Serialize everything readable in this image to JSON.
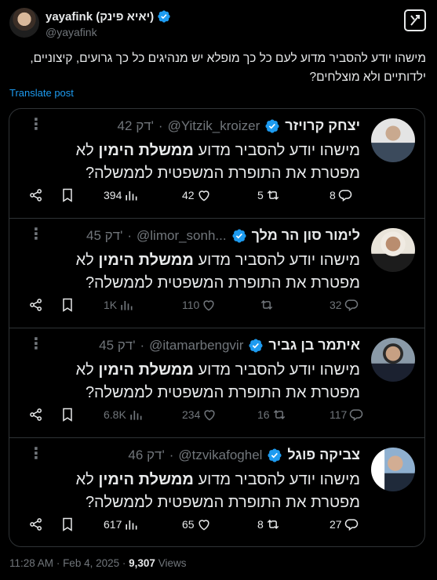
{
  "author": {
    "display_name": "yayafink (יאיא פינק)",
    "handle": "@yayafink"
  },
  "tweet": {
    "text": "מישהו יודע להסביר מדוע לעם כל כך מופלא יש מנהיגים כל כך גרועים, קיצוניים, ילדותיים ולא מוצלחים?"
  },
  "translate_label": "Translate post",
  "quotes": [
    {
      "name": "יצחק קרויזר",
      "handle": "@Yitzik_kroizer",
      "time": "42 דק'",
      "text_pre": "מישהו יודע להסביר מדוע",
      "text_bold": "ממשלת הימין",
      "text_post": "לא מפטרת את התופרת המשפטית לממשלה?",
      "replies": "8",
      "reposts": "5",
      "likes": "42",
      "views": "394",
      "dim": false
    },
    {
      "name": "לימור סון הר מלך",
      "handle": "@limor_sonh...",
      "time": "45 דק'",
      "text_pre": "מישהו יודע להסביר מדוע",
      "text_bold": "ממשלת הימין",
      "text_post": "לא מפטרת את התופרת המשפטית לממשלה?",
      "replies": "32",
      "reposts": "",
      "likes": "110",
      "views": "1K",
      "dim": true
    },
    {
      "name": "איתמר בן גביר",
      "handle": "@itamarbengvir",
      "time": "45 דק'",
      "text_pre": "מישהו יודע להסביר מדוע",
      "text_bold": "ממשלת הימין",
      "text_post": "לא מפטרת את התופרת המשפטית לממשלה?",
      "replies": "117",
      "reposts": "16",
      "likes": "234",
      "views": "6.8K",
      "dim": true
    },
    {
      "name": "צביקה פוגל",
      "handle": "@tzvikafoghel",
      "time": "46 דק'",
      "text_pre": "מישהו יודע להסביר מדוע",
      "text_bold": "ממשלת הימין",
      "text_post": "לא מפטרת את התופרת המשפטית לממשלה?",
      "replies": "27",
      "reposts": "8",
      "likes": "65",
      "views": "617",
      "dim": false
    }
  ],
  "meta": {
    "time": "11:28 AM",
    "date": "Feb 4, 2025",
    "views_count": "9,307",
    "views_label": "Views"
  },
  "colors": {
    "accent": "#1d9bf0",
    "text": "#e7e9ea",
    "muted": "#71767b",
    "border": "#2f3336"
  },
  "icons": [
    "verified-icon",
    "grok-icon",
    "more-icon",
    "reply-icon",
    "repost-icon",
    "like-icon",
    "views-icon",
    "bookmark-icon",
    "share-icon"
  ]
}
